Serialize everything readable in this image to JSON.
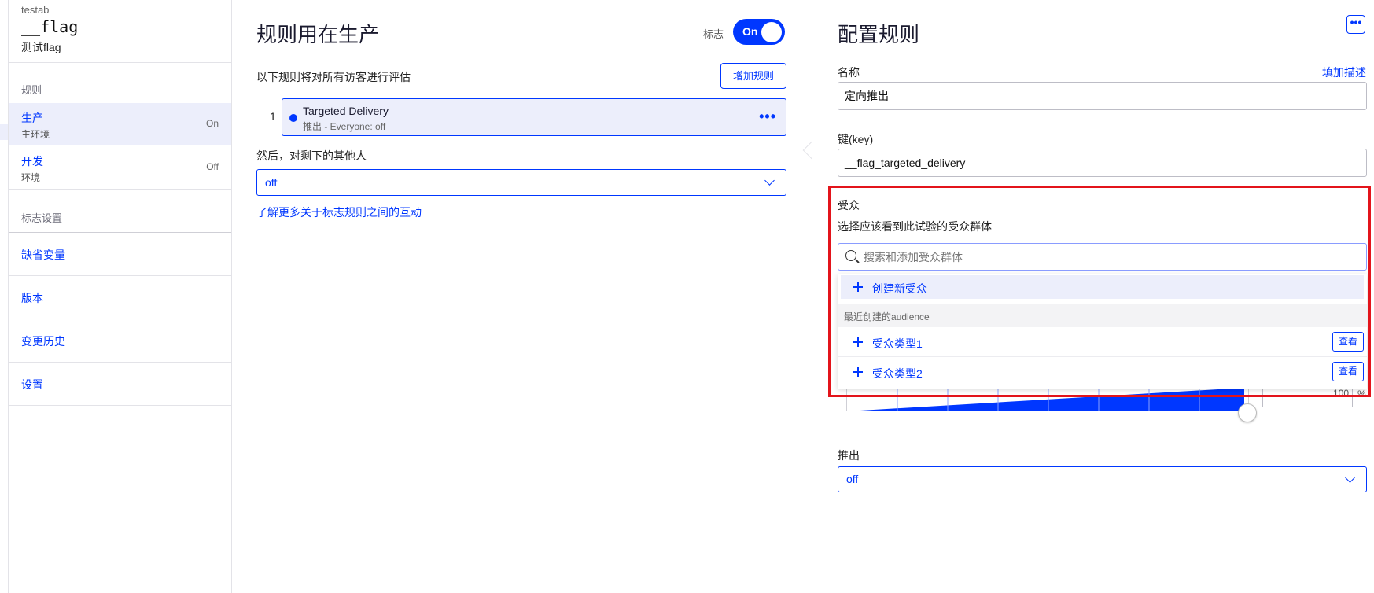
{
  "sidebar": {
    "project": "testab",
    "flag_key": "__flag",
    "flag_name": "测试flag",
    "rules_section": "规则",
    "environments": [
      {
        "name": "生产",
        "sub": "主环境",
        "status": "On"
      },
      {
        "name": "开发",
        "sub": "环境",
        "status": "Off"
      }
    ],
    "settings_section": "标志设置",
    "links": [
      "缺省变量",
      "版本",
      "变更历史",
      "设置"
    ]
  },
  "middle": {
    "title": "规则用在生产",
    "flag_label": "标志",
    "toggle_label": "On",
    "description": "以下规则将对所有访客进行评估",
    "add_rule": "增加规则",
    "rule": {
      "number": "1",
      "name": "Targeted Delivery",
      "sub": "推出 - Everyone: off",
      "more": "•••"
    },
    "then_label": "然后，对剩下的其他人",
    "fallback_value": "off",
    "learn_more": "了解更多关于标志规则之间的互动"
  },
  "right": {
    "title": "配置规则",
    "more": "•••",
    "name_label": "名称",
    "add_description": "填加描述",
    "name_value": "定向推出",
    "key_label": "键(key)",
    "key_value": "__flag_targeted_delivery",
    "audience_label": "受众",
    "audience_sub": "选择应该看到此试验的受众群体",
    "search_placeholder": "搜索和添加受众群体",
    "create_new": "创建新受众",
    "recent_group": "最近创建的audience",
    "audiences": [
      {
        "name": "受众类型1",
        "view": "查看"
      },
      {
        "name": "受众类型2",
        "view": "查看"
      }
    ],
    "traffic_percent": "100",
    "traffic_unit": "%",
    "rollout_label": "推出",
    "rollout_value": "off"
  },
  "colors": {
    "accent": "#0037ff",
    "highlight_box": "#e3141b",
    "selected_bg": "#eceefb"
  }
}
